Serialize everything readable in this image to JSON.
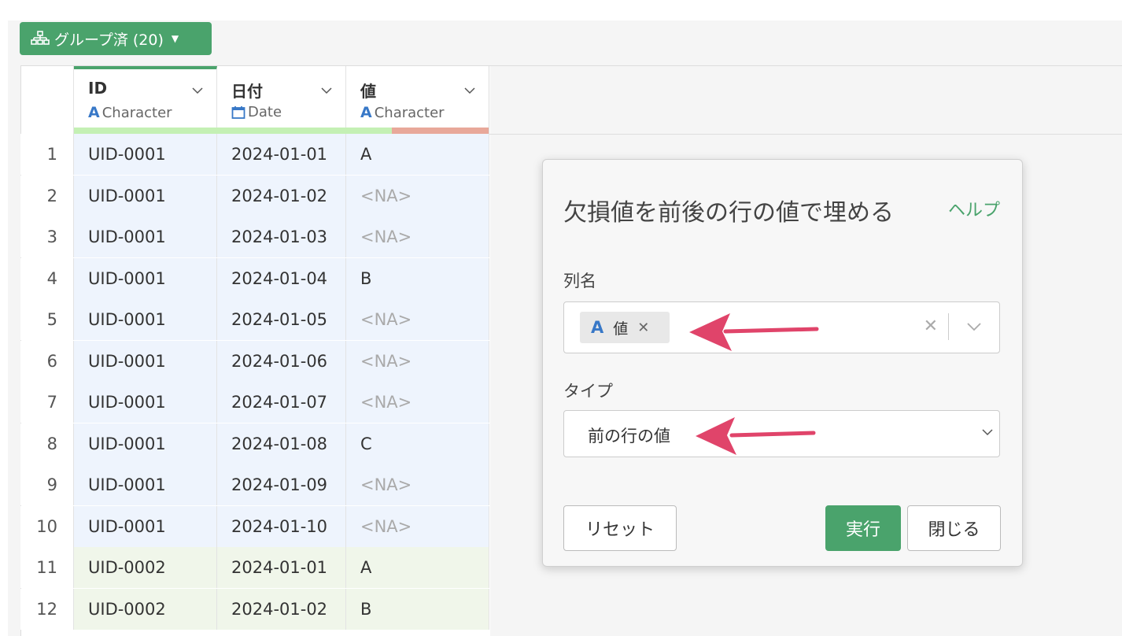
{
  "toolbar": {
    "group_label": "グループ済 (20)"
  },
  "columns": [
    {
      "name": "ID",
      "type": "Character"
    },
    {
      "name": "日付",
      "type": "Date"
    },
    {
      "name": "値",
      "type": "Character"
    }
  ],
  "rows": [
    {
      "num": "1",
      "id": "UID-0001",
      "date": "2024-01-01",
      "val": "A",
      "na": false,
      "group": 1
    },
    {
      "num": "2",
      "id": "UID-0001",
      "date": "2024-01-02",
      "val": "<NA>",
      "na": true,
      "group": 1
    },
    {
      "num": "3",
      "id": "UID-0001",
      "date": "2024-01-03",
      "val": "<NA>",
      "na": true,
      "group": 1
    },
    {
      "num": "4",
      "id": "UID-0001",
      "date": "2024-01-04",
      "val": "B",
      "na": false,
      "group": 1
    },
    {
      "num": "5",
      "id": "UID-0001",
      "date": "2024-01-05",
      "val": "<NA>",
      "na": true,
      "group": 1
    },
    {
      "num": "6",
      "id": "UID-0001",
      "date": "2024-01-06",
      "val": "<NA>",
      "na": true,
      "group": 1
    },
    {
      "num": "7",
      "id": "UID-0001",
      "date": "2024-01-07",
      "val": "<NA>",
      "na": true,
      "group": 1
    },
    {
      "num": "8",
      "id": "UID-0001",
      "date": "2024-01-08",
      "val": "C",
      "na": false,
      "group": 1
    },
    {
      "num": "9",
      "id": "UID-0001",
      "date": "2024-01-09",
      "val": "<NA>",
      "na": true,
      "group": 1
    },
    {
      "num": "10",
      "id": "UID-0001",
      "date": "2024-01-10",
      "val": "<NA>",
      "na": true,
      "group": 1
    },
    {
      "num": "11",
      "id": "UID-0002",
      "date": "2024-01-01",
      "val": "A",
      "na": false,
      "group": 2
    },
    {
      "num": "12",
      "id": "UID-0002",
      "date": "2024-01-02",
      "val": "B",
      "na": false,
      "group": 2
    }
  ],
  "dialog": {
    "title": "欠損値を前後の行の値で埋める",
    "help": "ヘルプ",
    "column_label": "列名",
    "selected_column": "値",
    "type_label": "タイプ",
    "type_value": "前の行の値",
    "reset": "リセット",
    "run": "実行",
    "close": "閉じる"
  },
  "colors": {
    "accent": "#4aa36c",
    "arrow": "#e0446a",
    "group1_bg": "#eef4fd",
    "group2_bg": "#f0f6ea",
    "type_char": "#3878c7"
  },
  "icons": [
    "group-icon",
    "caret-down-icon",
    "chevron-down-icon",
    "calendar-icon",
    "character-type-icon",
    "remove-icon",
    "clear-icon"
  ]
}
